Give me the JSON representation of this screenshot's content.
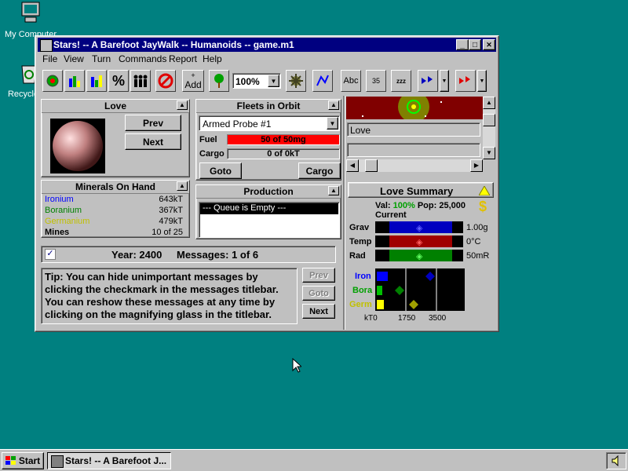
{
  "desktop": {
    "icons": [
      {
        "label": "My Computer"
      },
      {
        "label": "Recycle Bin"
      }
    ]
  },
  "window": {
    "title": "Stars! -- A Barefoot JayWalk -- Humanoids -- game.m1",
    "controls": {
      "minimize": "_",
      "maximize": "□",
      "close": "✕"
    }
  },
  "menu": [
    "File",
    "View",
    "Turn",
    "Commands",
    "Report",
    "Help"
  ],
  "toolbar": {
    "add_label": "Add",
    "zoom_value": "100%",
    "abc_label": "Abc",
    "num_label": "35"
  },
  "planet_panel": {
    "title": "Love",
    "prev": "Prev",
    "next": "Next"
  },
  "fleets_panel": {
    "title": "Fleets in Orbit",
    "selected_fleet": "Armed Probe #1",
    "fuel_label": "Fuel",
    "fuel_value": "50 of 50mg",
    "fuel_fraction": 1.0,
    "cargo_label": "Cargo",
    "cargo_value": "0 of 0kT",
    "goto": "Goto",
    "cargo_btn": "Cargo"
  },
  "minerals_panel": {
    "title": "Minerals On Hand",
    "rows": [
      {
        "name": "Ironium",
        "value": "643kT",
        "color": "#0000ff"
      },
      {
        "name": "Boranium",
        "value": "367kT",
        "color": "#008000"
      },
      {
        "name": "Germanium",
        "value": "479kT",
        "color": "#c0c000"
      }
    ],
    "mines_label": "Mines",
    "mines_value": "10 of 25"
  },
  "production_panel": {
    "title": "Production",
    "queue_text": "--- Queue is Empty ---"
  },
  "scanner": {
    "selected_name": "Love"
  },
  "summary": {
    "title": "Love Summary",
    "val_label": "Val:",
    "val_value": "100%",
    "pop_label": "Pop:",
    "pop_value": "25,000",
    "current_label": "Current",
    "hab": [
      {
        "label": "Grav",
        "value": "1.00g",
        "color": "#0000c0",
        "marker": "#4040ff"
      },
      {
        "label": "Temp",
        "value": "0°C",
        "color": "#a00000",
        "marker": "#ff4040"
      },
      {
        "label": "Rad",
        "value": "50mR",
        "color": "#008000",
        "marker": "#40ff40"
      }
    ],
    "mineral_chart": {
      "labels": [
        "Iron",
        "Bora",
        "Germ"
      ],
      "label_colors": [
        "#0000ff",
        "#00a000",
        "#c0c000"
      ],
      "axis_ticks": [
        "kT0",
        "1750",
        "3500"
      ]
    }
  },
  "messages": {
    "year_text": "Year: 2400",
    "messages_text": "Messages: 1 of 6",
    "body": "Tip: You can hide unimportant messages by clicking the checkmark in the messages titlebar. You can reshow these messages at any time by clicking on the magnifying glass in the titlebar.",
    "prev": "Prev",
    "goto": "Goto",
    "next": "Next"
  },
  "taskbar": {
    "start": "Start",
    "task": "Stars! -- A Barefoot J..."
  }
}
